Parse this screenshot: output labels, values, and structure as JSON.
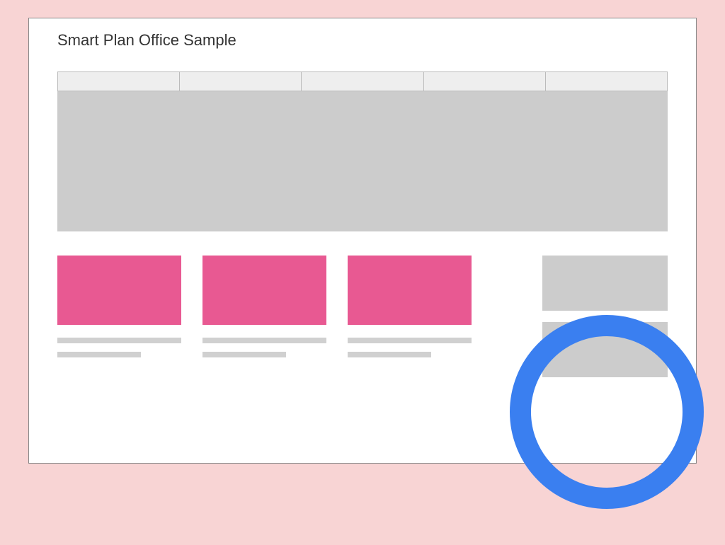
{
  "window": {
    "title": "Smart Plan Office Sample"
  },
  "nav": {
    "tabs": [
      {
        "label": ""
      },
      {
        "label": ""
      },
      {
        "label": ""
      },
      {
        "label": ""
      },
      {
        "label": ""
      }
    ]
  },
  "hero": {
    "label": ""
  },
  "cards": [
    {
      "title": "",
      "subtitle": "",
      "color": "pink"
    },
    {
      "title": "",
      "subtitle": "",
      "color": "pink"
    },
    {
      "title": "",
      "subtitle": "",
      "color": "pink"
    }
  ],
  "sidebar": {
    "blocks": [
      {
        "label": ""
      },
      {
        "label": ""
      }
    ]
  },
  "colors": {
    "background": "#f8d4d4",
    "card_pink": "#e85992",
    "placeholder_gray": "#cccccc",
    "highlight_blue": "#3a7ff0"
  }
}
